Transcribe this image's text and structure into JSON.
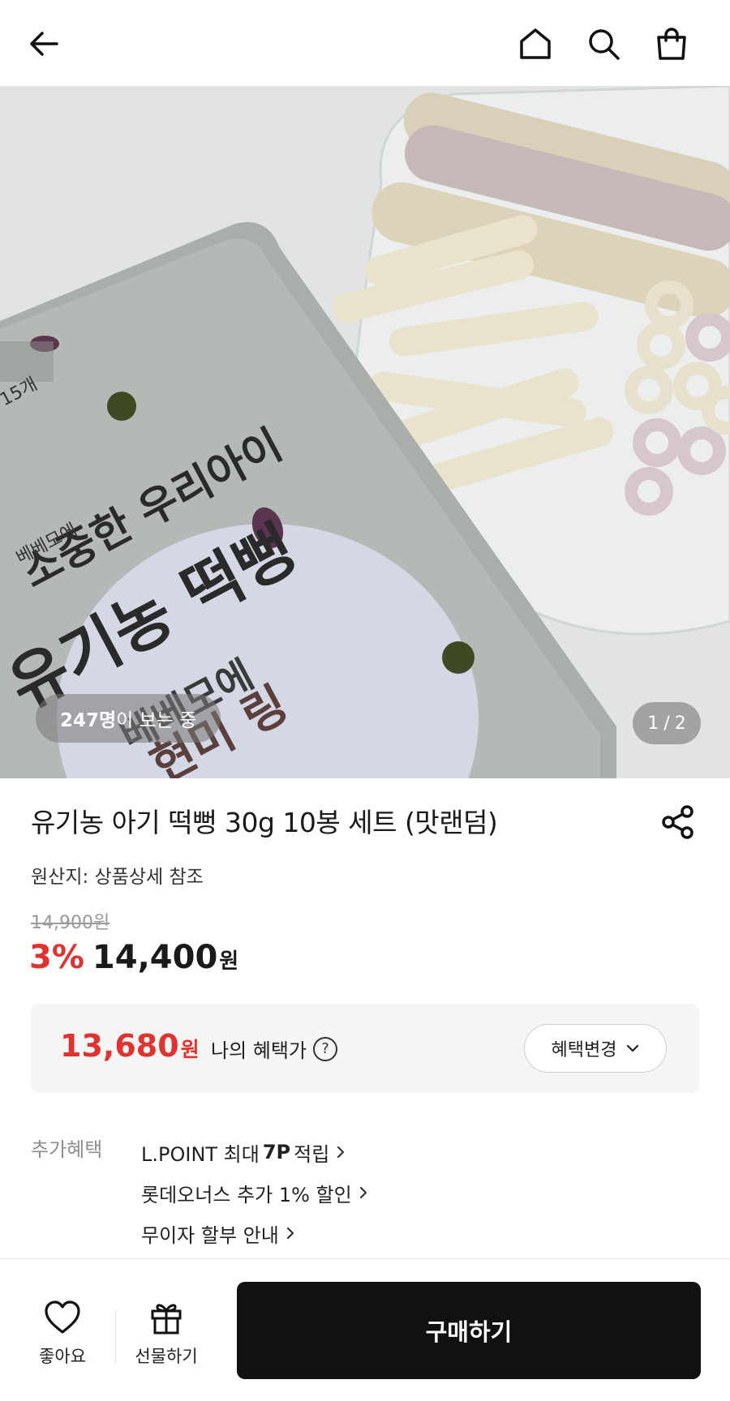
{
  "header": {
    "back_icon": "arrow-left-icon",
    "home_icon": "home-icon",
    "search_icon": "search-icon",
    "cart_icon": "shopping-bag-icon"
  },
  "hero": {
    "viewers_count": "247명",
    "viewers_suffix": "이 보는 중",
    "page_current": "1",
    "page_separator": "/",
    "page_total": "2",
    "package_text": {
      "brand": "베베모에",
      "tagline": "소중한 우리아이",
      "product": "유기농 떡뻥",
      "flavor": "현미 링",
      "brand_label": "베베모에",
      "count_tag": "15개"
    }
  },
  "product": {
    "title": "유기농 아기 떡뻥 30g 10봉 세트 (맛랜덤)",
    "origin": "원산지: 상품상세 참조",
    "original_price": "14,900원",
    "discount_rate": "3%",
    "price": "14,400",
    "price_unit": "원"
  },
  "benefit": {
    "price": "13,680",
    "unit": "원",
    "label": "나의 혜택가",
    "help_symbol": "?",
    "change_label": "혜택변경"
  },
  "extra": {
    "label": "추가혜택",
    "items": [
      {
        "prefix": "L.POINT 최대 ",
        "bold": "7P",
        "suffix": " 적립"
      },
      {
        "prefix": "롯데오너스 추가 1% 할인",
        "bold": "",
        "suffix": ""
      },
      {
        "prefix": "무이자 할부 안내",
        "bold": "",
        "suffix": ""
      }
    ]
  },
  "bottom": {
    "like_label": "좋아요",
    "gift_label": "선물하기",
    "buy_label": "구매하기"
  },
  "colors": {
    "accent_red": "#e0322f",
    "buy_button": "#111111"
  }
}
